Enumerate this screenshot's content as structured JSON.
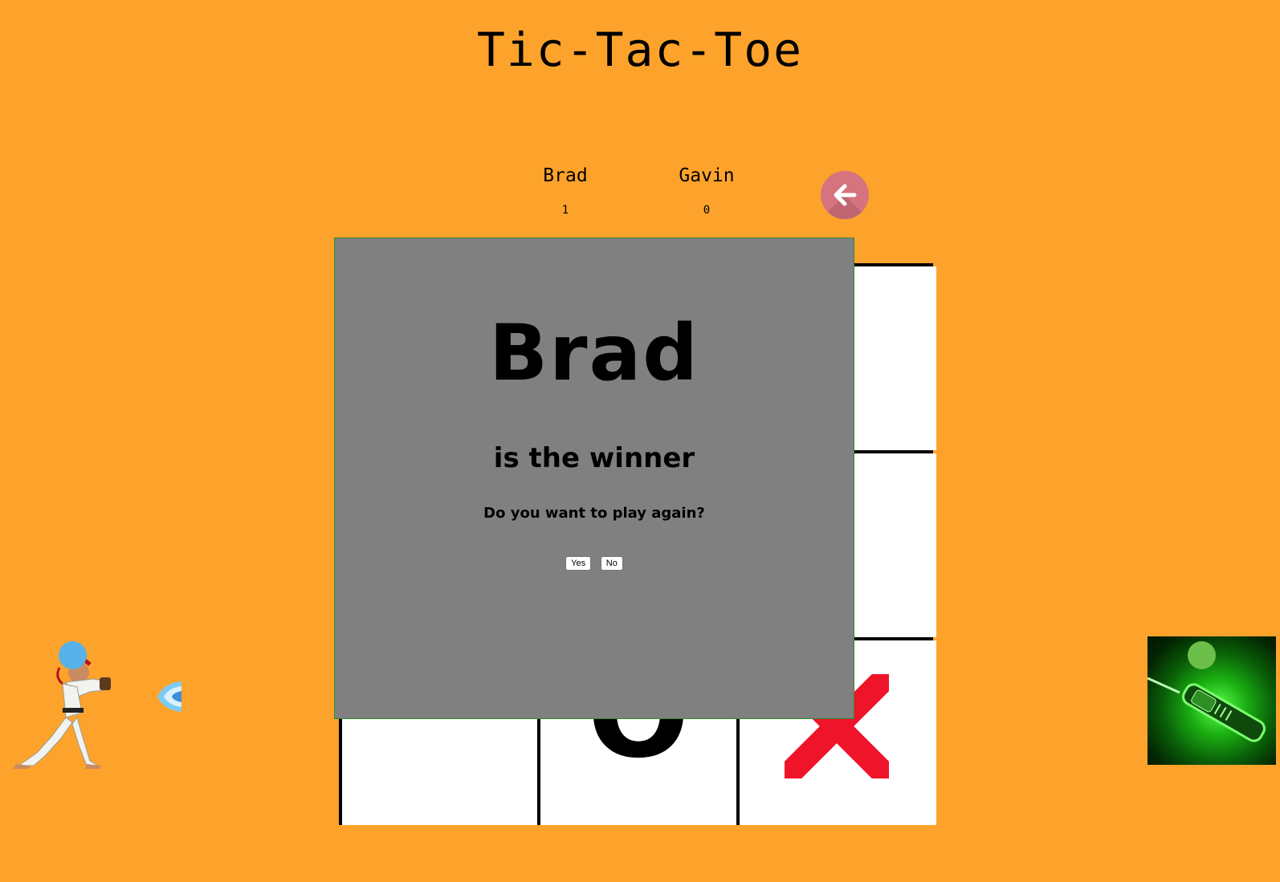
{
  "game": {
    "title": "Tic-Tac-Toe"
  },
  "players": [
    {
      "name": "Brad",
      "score": "1",
      "indicator_color": "#57B2EA"
    },
    {
      "name": "Gavin",
      "score": "0",
      "indicator_color": "#6CBF4A"
    }
  ],
  "back_button": {
    "icon": "arrow-left-icon"
  },
  "board": {
    "cells": [
      "",
      "",
      "",
      "",
      "",
      "",
      "",
      "O",
      "X"
    ],
    "visible_marks": {
      "o": "O",
      "x": "X"
    },
    "x_color": "#F0142A"
  },
  "winner_modal": {
    "winner_name": "Brad",
    "message": "is the winner",
    "prompt": "Do you want to play again?",
    "yes_label": "Yes",
    "no_label": "No"
  },
  "colors": {
    "background": "#FDA32C",
    "modal_background": "#808080",
    "back_button": "#D5737E"
  }
}
